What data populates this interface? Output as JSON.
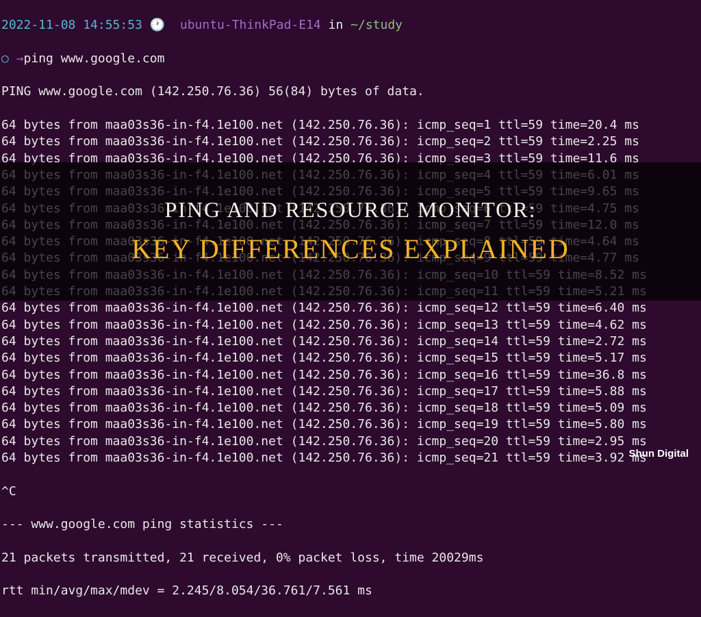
{
  "prompt": {
    "timestamp": "2022-11-08 14:55:53",
    "clock": "🕐",
    "hostname": "ubuntu-ThinkPad-E14",
    "in_word": "in",
    "path": "~/study",
    "circle": "○",
    "arrow": "→",
    "command": "ping www.google.com"
  },
  "ping_header": "PING www.google.com (142.250.76.36) 56(84) bytes of data.",
  "ping_lines": [
    {
      "seq": 1,
      "time": "20.4"
    },
    {
      "seq": 2,
      "time": "2.25"
    },
    {
      "seq": 3,
      "time": "11.6"
    },
    {
      "seq": 4,
      "time": "6.01"
    },
    {
      "seq": 5,
      "time": "9.65"
    },
    {
      "seq": 6,
      "time": "4.75"
    },
    {
      "seq": 7,
      "time": "12.0"
    },
    {
      "seq": 8,
      "time": "4.64"
    },
    {
      "seq": 9,
      "time": "4.77"
    },
    {
      "seq": 10,
      "time": "8.52"
    },
    {
      "seq": 11,
      "time": "5.21"
    },
    {
      "seq": 12,
      "time": "6.40"
    },
    {
      "seq": 13,
      "time": "4.62"
    },
    {
      "seq": 14,
      "time": "2.72"
    },
    {
      "seq": 15,
      "time": "5.17"
    },
    {
      "seq": 16,
      "time": "36.8"
    },
    {
      "seq": 17,
      "time": "5.88"
    },
    {
      "seq": 18,
      "time": "5.09"
    },
    {
      "seq": 19,
      "time": "5.80"
    },
    {
      "seq": 20,
      "time": "2.95"
    },
    {
      "seq": 21,
      "time": "3.92"
    }
  ],
  "ping_template": {
    "prefix": "64 bytes from maa03s36-in-f4.1e100.net (142.250.76.36): icmp_seq=",
    "mid": " ttl=59 time=",
    "suffix": " ms"
  },
  "interrupt": "^C",
  "stats_header": "--- www.google.com ping statistics ---",
  "stats_line1": "21 packets transmitted, 21 received, 0% packet loss, time 20029ms",
  "stats_line2": "rtt min/avg/max/mdev = 2.245/8.054/36.761/7.561 ms",
  "overlay": {
    "line1": "PING AND RESOURCE MONITOR:",
    "line2": "KEY DIFFERENCES EXPLAINED"
  },
  "watermark": "Shun Digital"
}
